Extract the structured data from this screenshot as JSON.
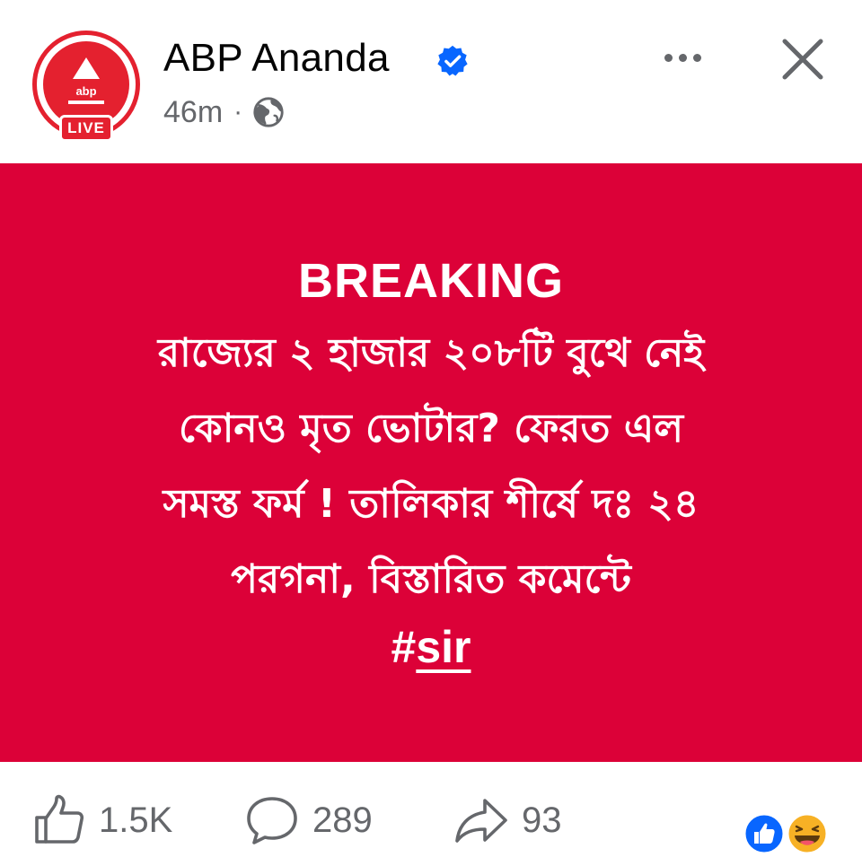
{
  "header": {
    "page_name": "ABP Ananda",
    "timestamp": "46m",
    "separator": "·",
    "avatar": {
      "brand": "abp",
      "live_label": "LIVE"
    },
    "icons": {
      "verified": "verified-badge-icon",
      "audience": "globe-icon",
      "more": "more-options-icon",
      "close": "close-icon"
    }
  },
  "post": {
    "headline": "BREAKING",
    "lines": [
      "রাজ্যের ২ হাজার ২০৮টি বুথে নেই",
      "কোনও মৃত ভোটার? ফেরত এল",
      "সমস্ত ফর্ম ! তালিকার শীর্ষে দঃ ২৪",
      "পরগনা, বিস্তারিত কমেন্টে"
    ],
    "hashtag_prefix": "#",
    "hashtag": "sir",
    "background_color": "#dc0138"
  },
  "actions": {
    "likes": "1.5K",
    "comments": "289",
    "shares": "93",
    "reactions": [
      "like-reaction-icon",
      "haha-reaction-icon"
    ]
  },
  "colors": {
    "brand_red": "#e4212f",
    "verified_blue": "#0866ff",
    "secondary_text": "#65676b"
  }
}
